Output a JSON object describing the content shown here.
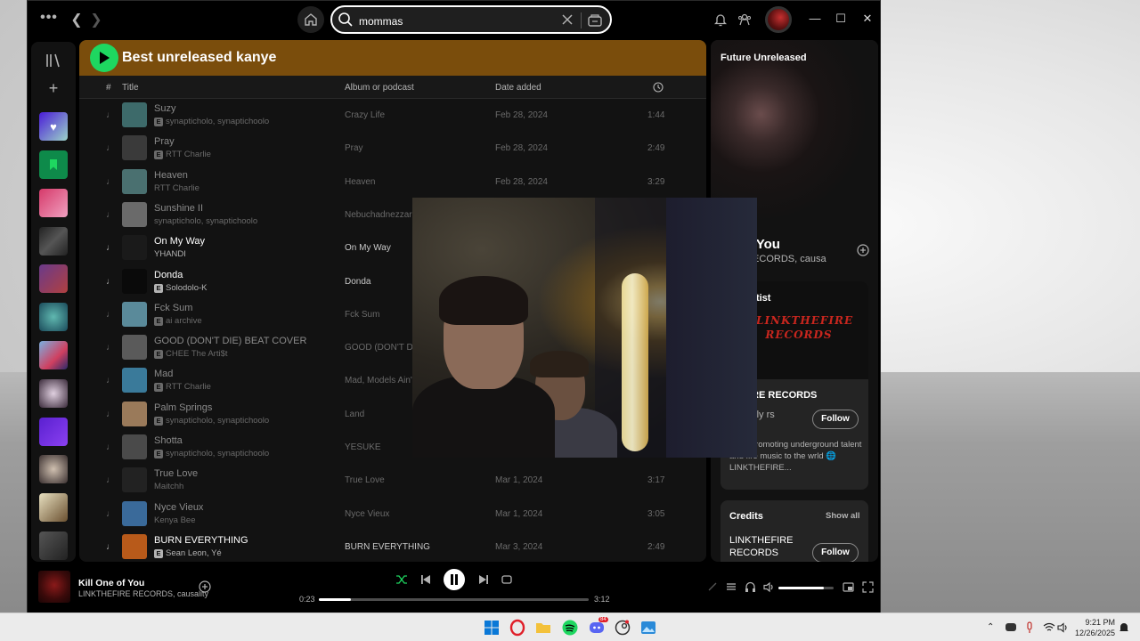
{
  "search": {
    "value": "mommas"
  },
  "playlist": {
    "title": "Best unreleased kanye",
    "columns": {
      "num": "#",
      "title": "Title",
      "album": "Album or podcast",
      "date": "Date added"
    },
    "tracks": [
      {
        "title": "Suzy",
        "explicit": true,
        "artist": "synapticholо, synaptichoolo",
        "album": "Crazy Life",
        "date": "Feb 28, 2024",
        "duration": "1:44",
        "thumb": "#3d6a6a",
        "bright": false
      },
      {
        "title": "Pray",
        "explicit": true,
        "artist": "RTT Charlie",
        "album": "Pray",
        "date": "Feb 28, 2024",
        "duration": "2:49",
        "thumb": "#3a3a3a",
        "bright": false
      },
      {
        "title": "Heaven",
        "explicit": false,
        "artist": "RTT Charlie",
        "album": "Heaven",
        "date": "Feb 28, 2024",
        "duration": "3:29",
        "thumb": "#4a7070",
        "bright": false
      },
      {
        "title": "Sunshine II",
        "explicit": false,
        "artist": "synapticholо, synaptichoolo",
        "album": "Nebuchadnezzar",
        "date": "",
        "duration": "",
        "thumb": "#6a6a6a",
        "bright": false
      },
      {
        "title": "On My Way",
        "explicit": false,
        "artist": "YHANDI",
        "album": "On My Way",
        "date": "",
        "duration": "",
        "thumb": "#1a1a1a",
        "bright": true
      },
      {
        "title": "Donda",
        "explicit": true,
        "artist": "Solodolo-K",
        "album": "Donda",
        "date": "",
        "duration": "",
        "thumb": "#0a0a0a",
        "bright": true
      },
      {
        "title": "Fck Sum",
        "explicit": true,
        "artist": "ai archive",
        "album": "Fck Sum",
        "date": "",
        "duration": "",
        "thumb": "#5a8a9a",
        "bright": false
      },
      {
        "title": "GOOD (DON'T DIE) BEAT COVER",
        "explicit": true,
        "artist": "CHEE The Arti$t",
        "album": "GOOD (DON'T DIE",
        "date": "",
        "duration": "",
        "thumb": "#5a5a5a",
        "bright": false
      },
      {
        "title": "Mad",
        "explicit": true,
        "artist": "RTT Charlie",
        "album": "Mad, Models Ain't I",
        "date": "",
        "duration": "",
        "thumb": "#3a7a9a",
        "bright": false
      },
      {
        "title": "Palm Springs",
        "explicit": true,
        "artist": "synapticholо, synaptichoolo",
        "album": "Land",
        "date": "",
        "duration": "",
        "thumb": "#9a7a5a",
        "bright": false
      },
      {
        "title": "Shotta",
        "explicit": true,
        "artist": "synapticholо, synaptichoolo",
        "album": "YESUKE",
        "date": "",
        "duration": "",
        "thumb": "#4a4a4a",
        "bright": false
      },
      {
        "title": "True Love",
        "explicit": false,
        "artist": "Maitchh",
        "album": "True Love",
        "date": "Mar 1, 2024",
        "duration": "3:17",
        "thumb": "#222",
        "bright": false
      },
      {
        "title": "Nyce Vieux",
        "explicit": false,
        "artist": "Kenya Bee",
        "album": "Nyce Vieux",
        "date": "Mar 1, 2024",
        "duration": "3:05",
        "thumb": "#3a6a9a",
        "bright": false
      },
      {
        "title": "BURN EVERYTHING",
        "explicit": true,
        "artist": "Sean Leon, Yé",
        "album": "BURN EVERYTHING",
        "date": "Mar 3, 2024",
        "duration": "2:49",
        "thumb": "#b85a1a",
        "bright": true
      }
    ]
  },
  "now_playing_panel": {
    "header": "Future Unreleased",
    "song": "ne of You",
    "artist": "FIRE RECORDS, causa",
    "about_label": "the artist",
    "artist_logo": "LINKTHEFIRE RECORDS",
    "artist_name": "HEFIRE RECORDS",
    "listeners": "monthly rs",
    "follow": "Follow",
    "bio": "ed to promoting underground talent and fire music to the wrld 🌐 LINKTHEFIRE...",
    "credits_title": "Credits",
    "credits_show_all": "Show all",
    "credits_name": "LINKTHEFIRE RECORDS",
    "credits_follow": "Follow"
  },
  "player": {
    "song": "Kill One of You",
    "artist": "LINKTHEFIRE RECORDS, causality",
    "elapsed": "0:23",
    "total": "3:12",
    "progress": 0.12,
    "volume": 0.82
  },
  "taskbar": {
    "time": "9:21 PM",
    "date": "12/26/2025",
    "discord_badge": "84"
  },
  "colors": {
    "spotify_green": "#1ed760",
    "header_bg": "#7a4d0c",
    "panel_bg": "#121212"
  }
}
